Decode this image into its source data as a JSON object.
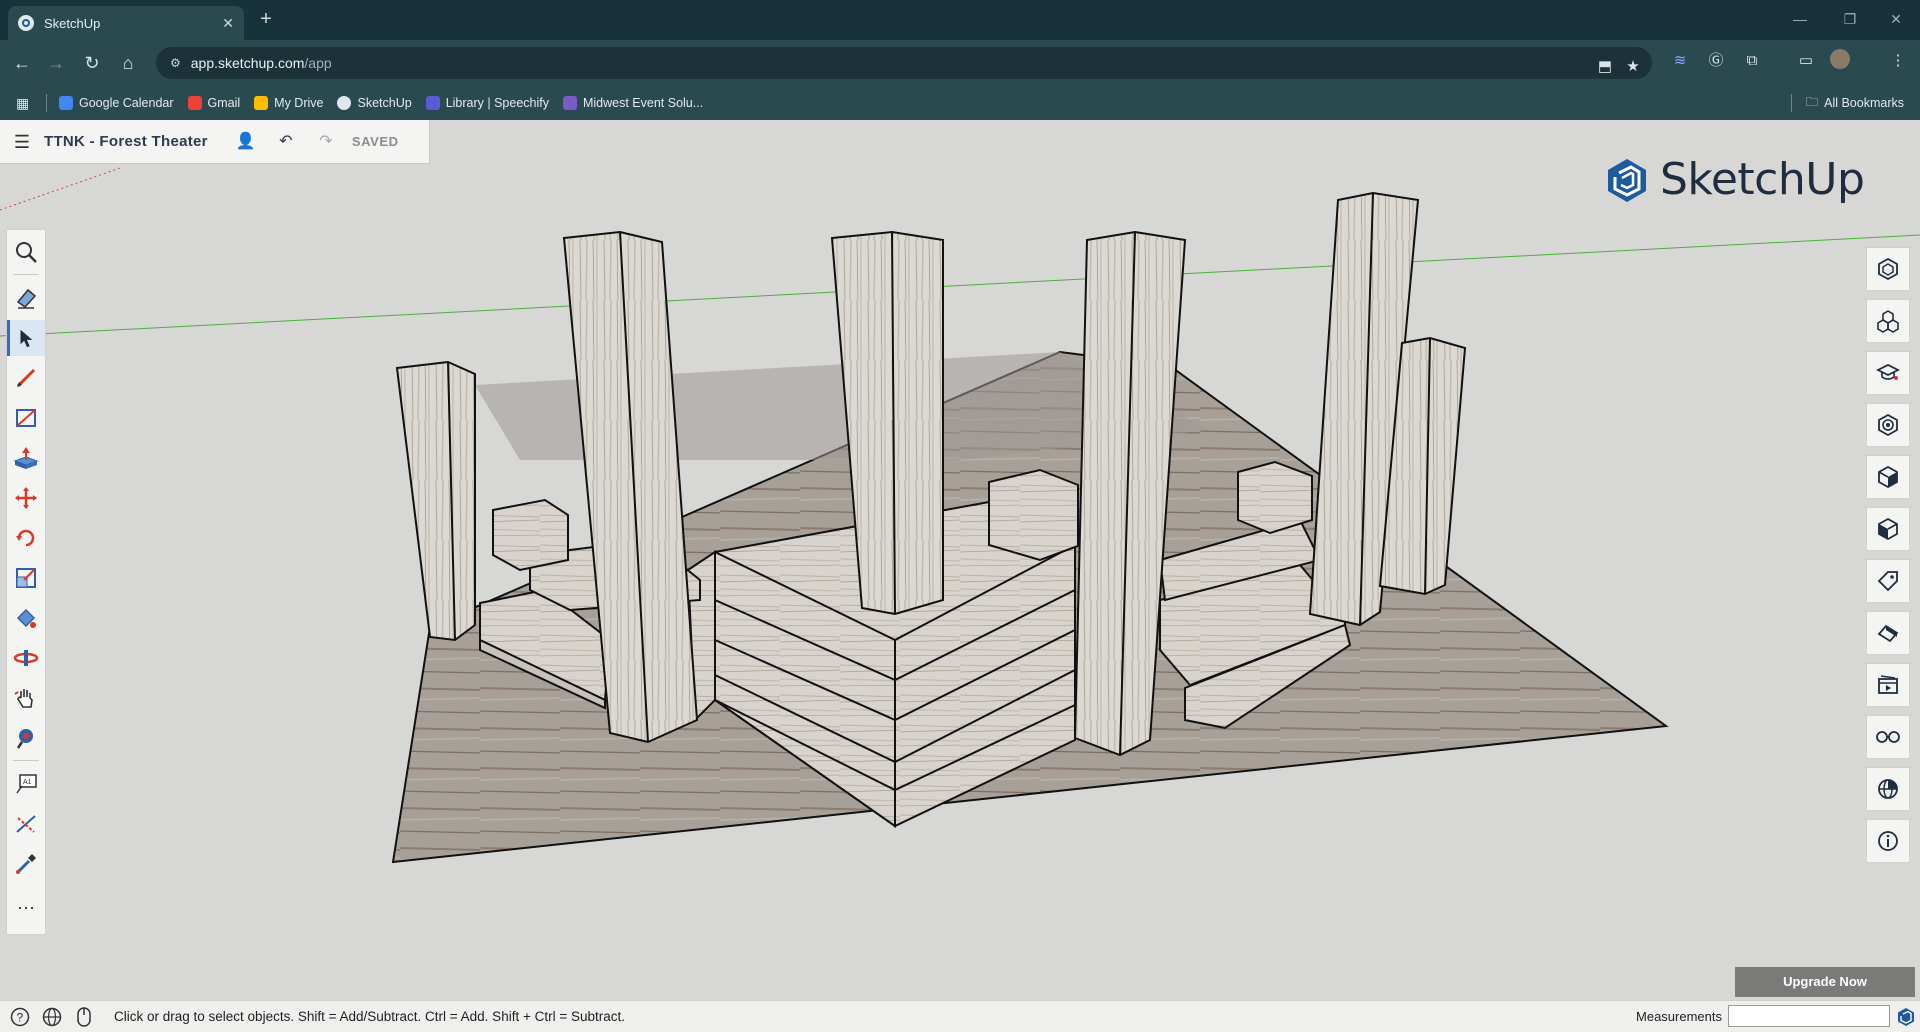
{
  "browser": {
    "tab_title": "SketchUp",
    "tab_close": "✕",
    "new_tab": "+",
    "url_domain": "app.sketchup.com",
    "url_path": "/app",
    "window_controls": [
      "—",
      "❐",
      "✕"
    ],
    "bookmarks": [
      {
        "label": "Google Calendar",
        "color": "#4285f4"
      },
      {
        "label": "Gmail",
        "color": "#ea4335"
      },
      {
        "label": "My Drive",
        "color": "#fbbc04"
      },
      {
        "label": "SketchUp",
        "color": "#dfe9ec"
      },
      {
        "label": "Library | Speechify",
        "color": "#5b5bd6"
      },
      {
        "label": "Midwest Event Solu...",
        "color": "#7a5cc8"
      }
    ],
    "all_bookmarks": "All Bookmarks"
  },
  "app": {
    "model_title": "TTNK - Forest Theater",
    "save_state": "SAVED",
    "logo_text": "SketchUp",
    "upgrade_label": "Upgrade Now",
    "status_text": "Click or drag to select objects. Shift = Add/Subtract. Ctrl = Add. Shift + Ctrl = Subtract.",
    "measurements_label": "Measurements",
    "measurements_value": ""
  },
  "left_toolbar": [
    "search-icon",
    "eraser-icon",
    "select-arrow-icon",
    "pencil-icon",
    "rectangle-icon",
    "push-pull-icon",
    "move-icon",
    "rotate-icon",
    "scale-icon",
    "paint-bucket-icon",
    "orbit-icon",
    "pan-hand-icon",
    "zoom-window-icon",
    "text-icon",
    "dimension-icon",
    "eyedropper-icon",
    "more-icon"
  ],
  "right_toolbar": [
    "entity-info-icon",
    "components-icon",
    "instructor-icon",
    "outliner-icon",
    "styles-icon",
    "materials-icon",
    "tags-icon",
    "scenes-icon",
    "shadows-icon",
    "display-icon",
    "geo-location-icon",
    "info-icon"
  ],
  "colors": {
    "chrome_dark": "#17323a",
    "chrome_mid": "#2a4a50",
    "viewport_bg": "#d7d7d5",
    "select_accent": "#2f6bd6",
    "tool_red": "#d63a2a",
    "logo_blue": "#1e5a9c"
  }
}
